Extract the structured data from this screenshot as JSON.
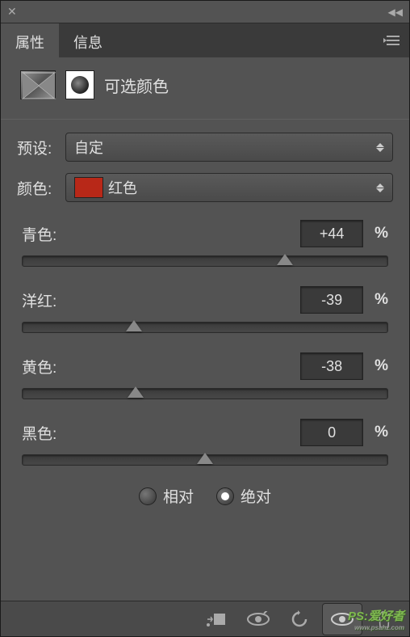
{
  "tabs": {
    "properties": "属性",
    "info": "信息"
  },
  "adjustment": {
    "title": "可选颜色"
  },
  "preset": {
    "label": "预设:",
    "value": "自定"
  },
  "color": {
    "label": "颜色:",
    "value": "红色",
    "swatch": "#b82818"
  },
  "sliders": {
    "cyan": {
      "label": "青色:",
      "value": "+44",
      "position": 72
    },
    "magenta": {
      "label": "洋红:",
      "value": "-39",
      "position": 30.5
    },
    "yellow": {
      "label": "黄色:",
      "value": "-38",
      "position": 31
    },
    "black": {
      "label": "黑色:",
      "value": "0",
      "position": 50
    }
  },
  "method": {
    "relative": "相对",
    "absolute": "绝对"
  },
  "watermark": {
    "main": "PS:爱好者",
    "sub": "www.psahz.com"
  }
}
